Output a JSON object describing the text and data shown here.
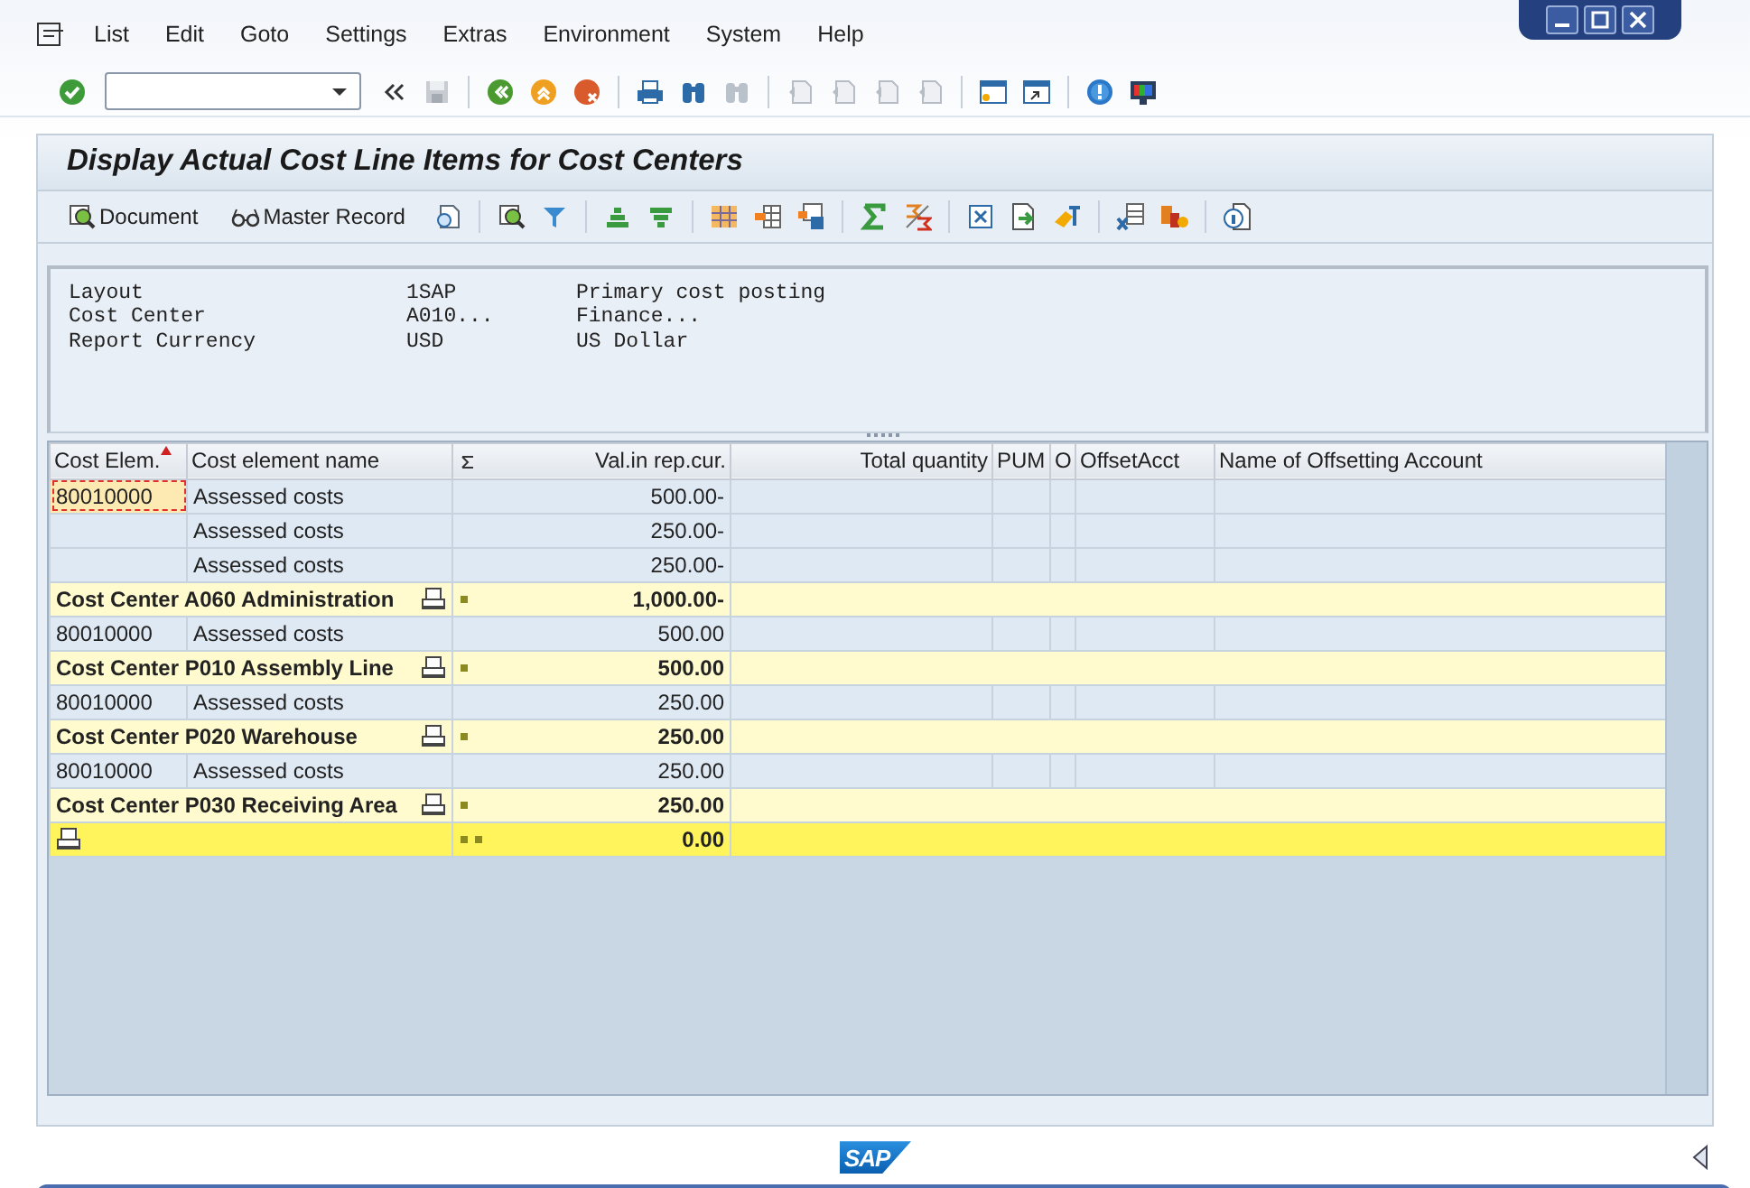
{
  "menu": [
    {
      "label": "List"
    },
    {
      "label": "Edit"
    },
    {
      "label": "Goto"
    },
    {
      "label": "Settings"
    },
    {
      "label": "Extras"
    },
    {
      "label": "Environment"
    },
    {
      "label": "System"
    },
    {
      "label": "Help"
    }
  ],
  "title": "Display Actual Cost Line Items for Cost Centers",
  "app_toolbar": {
    "buttons": [
      {
        "label": "Document",
        "kind": "document"
      },
      {
        "label": "Master Record",
        "kind": "master"
      }
    ]
  },
  "header_info": [
    {
      "label": "Layout",
      "value": "1SAP",
      "description": "Primary cost posting"
    },
    {
      "label": "Cost Center",
      "value": "A010...",
      "description": "Finance..."
    },
    {
      "label": "Report Currency",
      "value": "USD",
      "description": "US Dollar"
    }
  ],
  "table": {
    "columns": [
      {
        "label": "Cost Elem.",
        "kind": "text",
        "sorted": true,
        "summed": false
      },
      {
        "label": "Cost element name",
        "kind": "text",
        "sorted": false,
        "summed": false
      },
      {
        "label": "Val.in rep.cur.",
        "kind": "number",
        "sorted": false,
        "summed": true
      },
      {
        "label": "Total quantity",
        "kind": "number",
        "sorted": false,
        "summed": false
      },
      {
        "label": "PUM",
        "kind": "text",
        "sorted": false,
        "summed": false
      },
      {
        "label": "O",
        "kind": "text",
        "sorted": false,
        "summed": false
      },
      {
        "label": "OffsetAcct",
        "kind": "text",
        "sorted": false,
        "summed": false
      },
      {
        "label": "Name of Offsetting Account",
        "kind": "text",
        "sorted": false,
        "summed": false
      }
    ],
    "rows": [
      {
        "kind": "item",
        "cost_element": "80010000",
        "name": "Assessed costs",
        "value": "500.00-",
        "selected": true
      },
      {
        "kind": "item",
        "name": "Assessed costs",
        "value": "250.00-",
        "selected": false
      },
      {
        "kind": "item",
        "name": "Assessed costs",
        "value": "250.00-",
        "selected": false
      },
      {
        "kind": "subtotal",
        "label": "Cost Center A060 Administration",
        "value": "1,000.00-"
      },
      {
        "kind": "item",
        "cost_element": "80010000",
        "name": "Assessed costs",
        "value": "500.00",
        "selected": false
      },
      {
        "kind": "subtotal",
        "label": "Cost Center P010 Assembly Line",
        "value": "500.00"
      },
      {
        "kind": "item",
        "cost_element": "80010000",
        "name": "Assessed costs",
        "value": "250.00",
        "selected": false
      },
      {
        "kind": "subtotal",
        "label": "Cost Center P020 Warehouse",
        "value": "250.00"
      },
      {
        "kind": "item",
        "cost_element": "80010000",
        "name": "Assessed costs",
        "value": "250.00",
        "selected": false
      },
      {
        "kind": "subtotal",
        "label": "Cost Center P030 Receiving Area",
        "value": "250.00"
      },
      {
        "kind": "total",
        "value": "0.00"
      }
    ]
  },
  "footer": {
    "logo": "SAP"
  }
}
